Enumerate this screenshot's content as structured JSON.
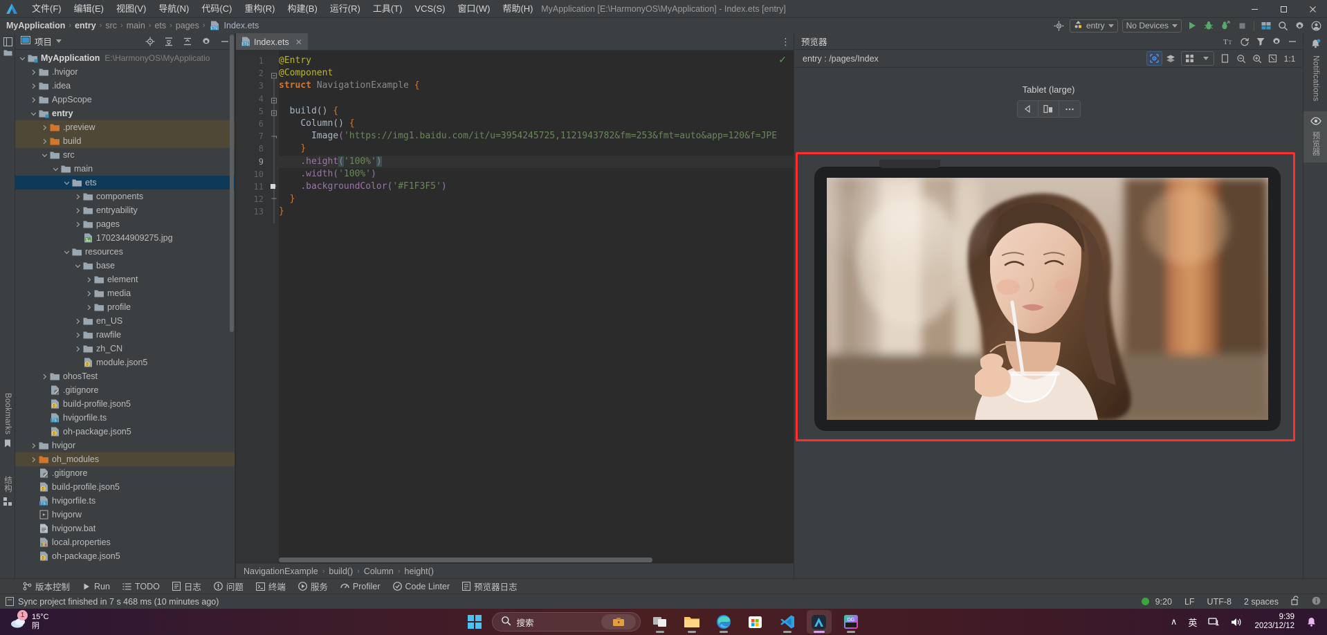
{
  "window": {
    "title": "MyApplication [E:\\HarmonyOS\\MyApplication] - Index.ets [entry]",
    "minimize": "–",
    "maximize": "❐",
    "close": "✕"
  },
  "menubar": {
    "items": [
      {
        "label": "文件(F)",
        "name": "menu-file"
      },
      {
        "label": "编辑(E)",
        "name": "menu-edit"
      },
      {
        "label": "视图(V)",
        "name": "menu-view"
      },
      {
        "label": "导航(N)",
        "name": "menu-navigate"
      },
      {
        "label": "代码(C)",
        "name": "menu-code"
      },
      {
        "label": "重构(R)",
        "name": "menu-refactor"
      },
      {
        "label": "构建(B)",
        "name": "menu-build"
      },
      {
        "label": "运行(R)",
        "name": "menu-run"
      },
      {
        "label": "工具(T)",
        "name": "menu-tools"
      },
      {
        "label": "VCS(S)",
        "name": "menu-vcs"
      },
      {
        "label": "窗口(W)",
        "name": "menu-window"
      },
      {
        "label": "帮助(H)",
        "name": "menu-help"
      }
    ]
  },
  "breadcrumb": {
    "items": [
      "MyApplication",
      "entry",
      "src",
      "main",
      "ets",
      "pages",
      "Index.ets"
    ],
    "separator": "›"
  },
  "toolbar": {
    "target_icon": "settings-sync-icon",
    "run_config": "entry",
    "device_select": "No Devices",
    "run_label": "run-icon",
    "debug_label": "debug-icon",
    "profile_label": "profile-icon",
    "stop_label": "stop-icon",
    "device_manager": "device-manager-icon",
    "search_label": "search-everywhere-icon",
    "settings_label": "settings-icon",
    "account_label": "account-icon"
  },
  "project_panel": {
    "title": "项目",
    "header_buttons": [
      "locate-icon",
      "expand-all-icon",
      "collapse-all-icon",
      "gear-icon",
      "minimize-icon"
    ],
    "tree": [
      {
        "label": "MyApplication",
        "path": "E:\\HarmonyOS\\MyApplicatio",
        "indent": 0,
        "arrow": "down",
        "icon": "module-folder",
        "bold": true,
        "state": ""
      },
      {
        "label": ".hvigor",
        "indent": 1,
        "arrow": "right",
        "icon": "folder",
        "state": ""
      },
      {
        "label": ".idea",
        "indent": 1,
        "arrow": "right",
        "icon": "folder",
        "state": ""
      },
      {
        "label": "AppScope",
        "indent": 1,
        "arrow": "right",
        "icon": "folder",
        "state": ""
      },
      {
        "label": "entry",
        "indent": 1,
        "arrow": "down",
        "icon": "module-folder",
        "bold": true,
        "state": ""
      },
      {
        "label": ".preview",
        "indent": 2,
        "arrow": "right",
        "icon": "folder-excluded",
        "state": "excl"
      },
      {
        "label": "build",
        "indent": 2,
        "arrow": "right",
        "icon": "folder-excluded",
        "state": "excl"
      },
      {
        "label": "src",
        "indent": 2,
        "arrow": "down",
        "icon": "folder",
        "state": ""
      },
      {
        "label": "main",
        "indent": 3,
        "arrow": "down",
        "icon": "folder",
        "state": ""
      },
      {
        "label": "ets",
        "indent": 4,
        "arrow": "down",
        "icon": "folder",
        "state": "sel"
      },
      {
        "label": "components",
        "indent": 5,
        "arrow": "right",
        "icon": "folder",
        "state": ""
      },
      {
        "label": "entryability",
        "indent": 5,
        "arrow": "right",
        "icon": "folder",
        "state": ""
      },
      {
        "label": "pages",
        "indent": 5,
        "arrow": "right",
        "icon": "folder",
        "state": ""
      },
      {
        "label": "1702344909275.jpg",
        "indent": 5,
        "arrow": "",
        "icon": "image-file",
        "state": ""
      },
      {
        "label": "resources",
        "indent": 4,
        "arrow": "down",
        "icon": "folder",
        "state": ""
      },
      {
        "label": "base",
        "indent": 5,
        "arrow": "down",
        "icon": "folder",
        "state": ""
      },
      {
        "label": "element",
        "indent": 6,
        "arrow": "right",
        "icon": "folder",
        "state": ""
      },
      {
        "label": "media",
        "indent": 6,
        "arrow": "right",
        "icon": "folder",
        "state": ""
      },
      {
        "label": "profile",
        "indent": 6,
        "arrow": "right",
        "icon": "folder",
        "state": ""
      },
      {
        "label": "en_US",
        "indent": 5,
        "arrow": "right",
        "icon": "folder",
        "state": ""
      },
      {
        "label": "rawfile",
        "indent": 5,
        "arrow": "right",
        "icon": "folder",
        "state": ""
      },
      {
        "label": "zh_CN",
        "indent": 5,
        "arrow": "right",
        "icon": "folder",
        "state": ""
      },
      {
        "label": "module.json5",
        "indent": 5,
        "arrow": "",
        "icon": "json5-file",
        "state": ""
      },
      {
        "label": "ohosTest",
        "indent": 2,
        "arrow": "right",
        "icon": "folder",
        "state": ""
      },
      {
        "label": ".gitignore",
        "indent": 2,
        "arrow": "",
        "icon": "gitignore-file",
        "state": ""
      },
      {
        "label": "build-profile.json5",
        "indent": 2,
        "arrow": "",
        "icon": "json5-file",
        "state": ""
      },
      {
        "label": "hvigorfile.ts",
        "indent": 2,
        "arrow": "",
        "icon": "ts-file",
        "state": ""
      },
      {
        "label": "oh-package.json5",
        "indent": 2,
        "arrow": "",
        "icon": "json5-file",
        "state": ""
      },
      {
        "label": "hvigor",
        "indent": 1,
        "arrow": "right",
        "icon": "folder",
        "state": ""
      },
      {
        "label": "oh_modules",
        "indent": 1,
        "arrow": "right",
        "icon": "folder-excluded",
        "state": "excl"
      },
      {
        "label": ".gitignore",
        "indent": 1,
        "arrow": "",
        "icon": "gitignore-file",
        "state": ""
      },
      {
        "label": "build-profile.json5",
        "indent": 1,
        "arrow": "",
        "icon": "json5-file",
        "state": ""
      },
      {
        "label": "hvigorfile.ts",
        "indent": 1,
        "arrow": "",
        "icon": "ts-file",
        "state": ""
      },
      {
        "label": "hvigorw",
        "indent": 1,
        "arrow": "",
        "icon": "script-file",
        "state": ""
      },
      {
        "label": "hvigorw.bat",
        "indent": 1,
        "arrow": "",
        "icon": "bat-file",
        "state": ""
      },
      {
        "label": "local.properties",
        "indent": 1,
        "arrow": "",
        "icon": "properties-file",
        "state": ""
      },
      {
        "label": "oh-package.json5",
        "indent": 1,
        "arrow": "",
        "icon": "json5-file",
        "state": ""
      }
    ]
  },
  "left_strip": {
    "project_label": "项目",
    "bookmarks_label": "Bookmarks",
    "structure_label": "结构"
  },
  "editor": {
    "tab_name": "Index.ets",
    "tab_close": "✕",
    "more_actions": "⋮",
    "inspection_ok": "✓",
    "line_numbers": [
      "1",
      "2",
      "3",
      "4",
      "5",
      "6",
      "7",
      "8",
      "9",
      "10",
      "11",
      "12",
      "13"
    ],
    "current_line": 9,
    "breakpoint_line": 11,
    "lines": [
      "@Entry",
      "@Component",
      "struct NavigationExample {",
      "",
      "  build() {",
      "    Column() {",
      "      Image('https://img1.baidu.com/it/u=3954245725,1121943782&fm=253&fmt=auto&app=120&f=JPE",
      "    }",
      "    .height('100%')",
      "    .width('100%')",
      "    .backgroundColor('#F1F3F5')",
      "  }",
      "}"
    ],
    "bottom_breadcrumb": [
      "NavigationExample",
      "build()",
      "Column",
      "height()"
    ]
  },
  "preview": {
    "title": "预览器",
    "head_buttons": [
      "font-size-icon",
      "refresh-icon",
      "filter-icon",
      "gear-icon",
      "minimize-icon"
    ],
    "path": "entry : /pages/Index",
    "toolbar_buttons": [
      "inspector-icon",
      "layers-icon",
      "grid-icon",
      "chevron-down-icon",
      "frame-icon",
      "zoom-out-icon",
      "zoom-in-icon",
      "fit-icon",
      "actual-size-icon"
    ],
    "actual_size_label": "1:1",
    "device_name": "Tablet (large)",
    "device_controls": [
      "rotate-icon",
      "multi-device-icon",
      "more-icon"
    ]
  },
  "right_strip": {
    "notifications_label": "Notifications",
    "preview_label": "预览器"
  },
  "toolwindows": {
    "items": [
      {
        "label": "版本控制",
        "icon": "vcs-icon",
        "name": "tool-version-control"
      },
      {
        "label": "Run",
        "icon": "run-icon",
        "name": "tool-run"
      },
      {
        "label": "TODO",
        "icon": "todo-icon",
        "name": "tool-todo"
      },
      {
        "label": "日志",
        "icon": "log-icon",
        "name": "tool-log"
      },
      {
        "label": "问题",
        "icon": "problems-icon",
        "name": "tool-problems"
      },
      {
        "label": "终端",
        "icon": "terminal-icon",
        "name": "tool-terminal"
      },
      {
        "label": "服务",
        "icon": "services-icon",
        "name": "tool-services"
      },
      {
        "label": "Profiler",
        "icon": "profiler-icon",
        "name": "tool-profiler"
      },
      {
        "label": "Code Linter",
        "icon": "linter-icon",
        "name": "tool-code-linter"
      },
      {
        "label": "预览器日志",
        "icon": "preview-log-icon",
        "name": "tool-preview-log"
      }
    ]
  },
  "statusbar": {
    "message": "Sync project finished in 7 s 468 ms (10 minutes ago)",
    "message_icon": "note-icon",
    "caret": "9:20",
    "line_separator": "LF",
    "encoding": "UTF-8",
    "indent": "2 spaces",
    "lock_icon": "unlocked-icon",
    "info_icon": "info-icon",
    "status_dot_color": "#3fa33f"
  },
  "taskbar": {
    "weather_temp": "15°C",
    "weather_desc": "阴",
    "weather_badge": "1",
    "search_placeholder": "搜索",
    "apps": [
      {
        "name": "taskview-icon",
        "running": true
      },
      {
        "name": "file-explorer-icon",
        "running": true
      },
      {
        "name": "edge-icon",
        "running": true
      },
      {
        "name": "microsoft-store-icon",
        "running": false
      },
      {
        "name": "vscode-icon",
        "running": true
      },
      {
        "name": "deveco-studio-icon",
        "running": true,
        "active": true
      },
      {
        "name": "datagrip-icon",
        "running": true
      }
    ],
    "tray": {
      "chevron": "∧",
      "ime": "英",
      "network_icon": "network-icon",
      "volume_icon": "volume-icon",
      "time": "9:39",
      "date": "2023/12/12",
      "bell_icon": "notification-bell-icon"
    }
  }
}
